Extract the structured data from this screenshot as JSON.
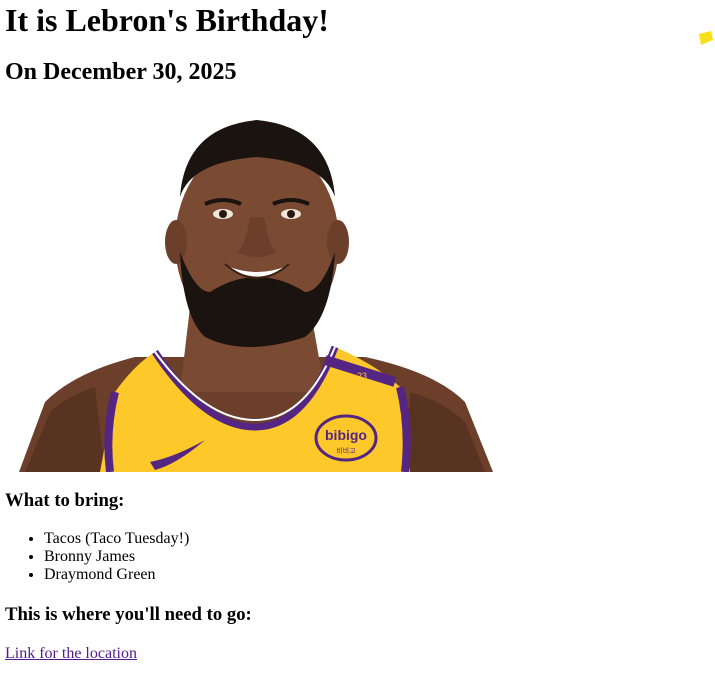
{
  "header": {
    "title": "It is Lebron's Birthday!",
    "date_line": "On December 30, 2025"
  },
  "photo": {
    "jersey_logo_text": "bibigo",
    "jersey_logo_subtext": "비비고",
    "strap_number": "23",
    "colors": {
      "jersey_gold": "#fdc82a",
      "jersey_purple": "#552583",
      "skin": "#7a4a32",
      "hair": "#1a1310",
      "nike": "#552583"
    }
  },
  "sticky_note": {
    "color": "#f7e01a"
  },
  "bring_section": {
    "heading": "What to bring:",
    "items": [
      "Tacos (Taco Tuesday!)",
      "Bronny James",
      "Draymond Green"
    ]
  },
  "location_section": {
    "heading": "This is where you'll need to go:",
    "link_text": "Link for the location"
  }
}
